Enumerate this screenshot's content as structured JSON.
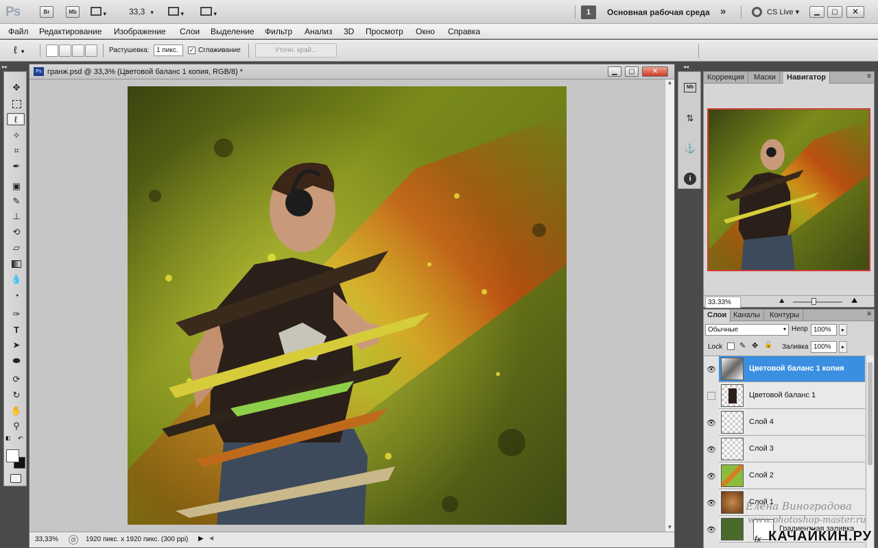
{
  "appbar": {
    "logo": "Ps",
    "bridge_label": "Br",
    "minibridge_label": "Mb",
    "zoom_value": "33,3",
    "workspace_number": "1",
    "workspace_label": "Основная рабочая среда",
    "cslive_label": "CS Live"
  },
  "menu": [
    "Файл",
    "Редактирование",
    "Изображение",
    "Слои",
    "Выделение",
    "Фильтр",
    "Анализ",
    "3D",
    "Просмотр",
    "Окно",
    "Справка"
  ],
  "options": {
    "feather_label": "Растушевка:",
    "feather_value": "1 пикс.",
    "antialias_label": "Сглаживание",
    "refine_edge_label": "Уточн. край..."
  },
  "document": {
    "title": "гранж.psd @ 33,3% (Цветовой баланс 1 копия, RGB/8) *",
    "icon_label": "Ps",
    "zoom_status": "33,33%",
    "size_status": "1920 пикс. x 1920 пикс. (300 ppi)"
  },
  "navigator": {
    "tabs": [
      "Коррекция",
      "Маски",
      "Навигатор"
    ],
    "active_tab": 2,
    "zoom": "33.33%"
  },
  "layers_panel": {
    "tabs": [
      "Слои",
      "Каналы",
      "Контуры"
    ],
    "blend_mode": "Обычные",
    "opacity_label": "Непр",
    "opacity_value": "100%",
    "lock_label": "Lock",
    "fill_label": "Заливка",
    "fill_value": "100%",
    "layers": [
      {
        "name": "Цветовой баланс 1 копия",
        "visible": true,
        "active": true
      },
      {
        "name": "Цветовой баланс 1",
        "visible": false,
        "active": false
      },
      {
        "name": "Слой 4",
        "visible": true,
        "active": false
      },
      {
        "name": "Слой 3",
        "visible": true,
        "active": false
      },
      {
        "name": "Слой 2",
        "visible": true,
        "active": false
      },
      {
        "name": "Слой 1",
        "visible": true,
        "active": false
      },
      {
        "name": "Градиентная заливка",
        "visible": true,
        "active": false
      }
    ]
  },
  "watermark": {
    "author": "Елена Виноградова",
    "site": "www.photoshop-master.ru",
    "brand": "КАЧАЙКИН.РУ"
  },
  "colors": {
    "active_layer": "#3b8fe0",
    "accent_red": "#d23b3b"
  }
}
